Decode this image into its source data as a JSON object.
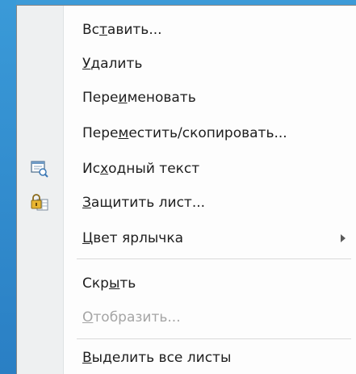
{
  "menu": {
    "items": [
      {
        "pre": "Вс",
        "u": "т",
        "post": "авить...",
        "disabled": false
      },
      {
        "pre": "",
        "u": "У",
        "post": "далить",
        "disabled": false
      },
      {
        "pre": "Пере",
        "u": "и",
        "post": "меновать",
        "disabled": false
      },
      {
        "pre": "Пере",
        "u": "м",
        "post": "естить/скопировать...",
        "disabled": false
      },
      {
        "pre": "Ис",
        "u": "х",
        "post": "одный текст",
        "disabled": false,
        "icon": "view-code-icon"
      },
      {
        "pre": "",
        "u": "З",
        "post": "ащитить лист...",
        "disabled": false,
        "icon": "lock-sheet-icon"
      },
      {
        "pre": "",
        "u": "Ц",
        "post": "вет ярлычка",
        "disabled": false,
        "submenu": true
      },
      {
        "pre": "Скр",
        "u": "ы",
        "post": "ть",
        "disabled": false
      },
      {
        "pre": "",
        "u": "О",
        "post": "тобразить...",
        "disabled": true
      },
      {
        "pre": "",
        "u": "В",
        "post": "ыделить все листы",
        "disabled": false
      }
    ]
  },
  "colors": {
    "accent": "#2f86c9",
    "disabled": "#a5a5a5",
    "text": "#1e1e1e"
  }
}
